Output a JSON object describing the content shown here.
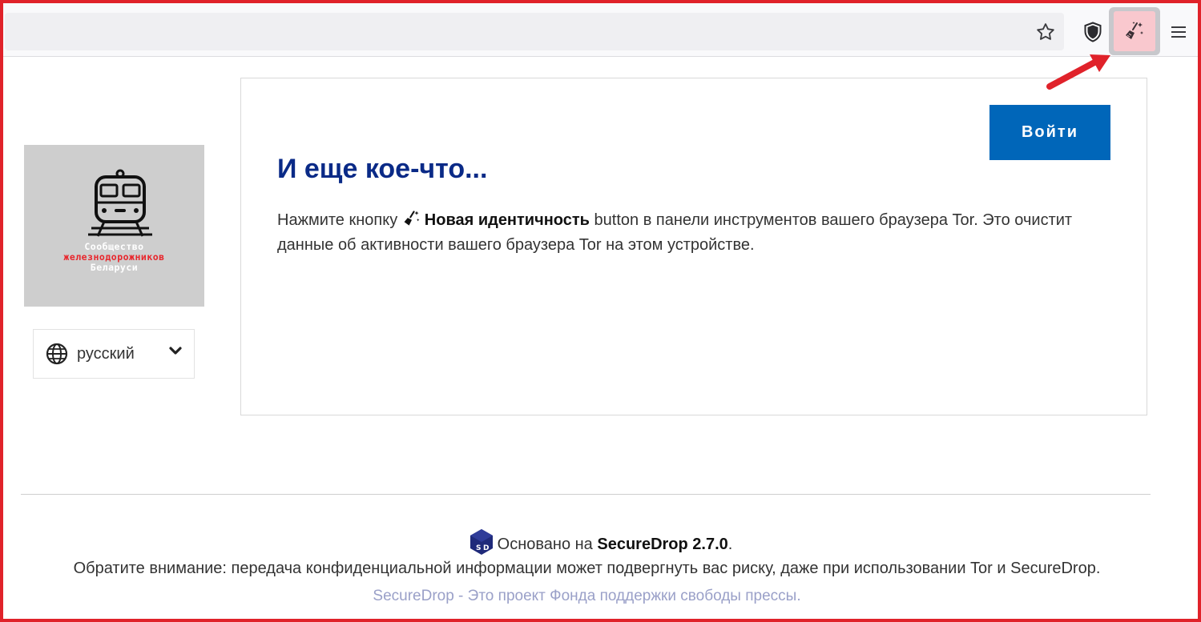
{
  "browser": {
    "toolbar": {
      "bookmark_icon": "star-icon",
      "security_icon": "shield-icon",
      "new_identity_icon": "broom-sparkle-icon",
      "menu_icon": "hamburger-menu-icon"
    },
    "highlight_color": "#e0222a"
  },
  "sidebar": {
    "logo": {
      "line1": "Сообщество",
      "line2": "железнодорожников",
      "line3": "Беларуси",
      "background": "#cecece"
    },
    "language": {
      "selected": "русский"
    }
  },
  "main": {
    "login_label": "Войти",
    "heading": "И еще кое-что...",
    "paragraph": {
      "before": "Нажмите кнопку",
      "bold": "Новая идентичность",
      "after": "button в панели инструментов вашего браузера Tor. Это очистит данные об активности вашего браузера Tor на этом устройстве."
    }
  },
  "footer": {
    "powered_prefix": "Основано на",
    "powered_product": "SecureDrop 2.7.0",
    "powered_suffix": ".",
    "warning": "Обратите внимание: передача конфиденциальной информации может подвергнуть вас риску, даже при использовании Tor и SecureDrop.",
    "project_link": "SecureDrop - Это проект Фонда поддержки свободы прессы."
  },
  "colors": {
    "heading": "#0a2a87",
    "button": "#0066b9",
    "link": "#9aa0c8"
  }
}
